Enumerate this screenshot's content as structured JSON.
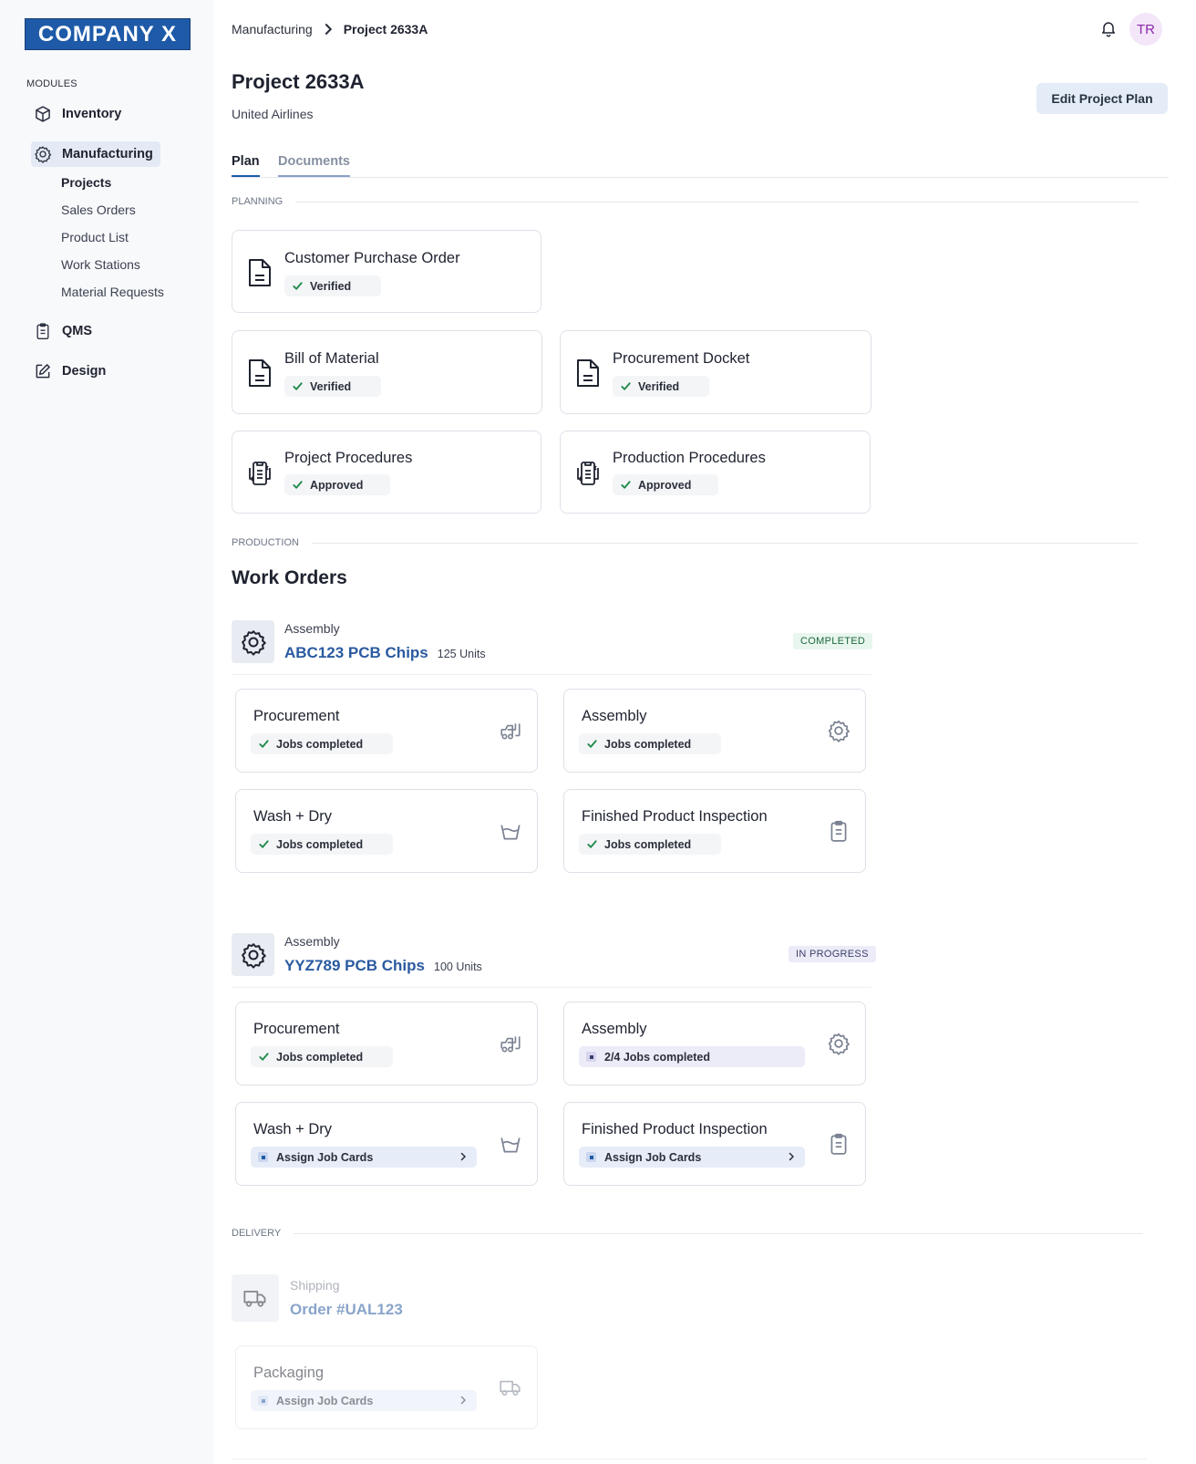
{
  "brand": {
    "logo": "COMPANY X"
  },
  "sidebar": {
    "section_label": "MODULES",
    "items": [
      {
        "label": "Inventory",
        "icon": "cube-icon"
      },
      {
        "label": "Manufacturing",
        "icon": "gear-icon",
        "active": true
      },
      {
        "label": "QMS",
        "icon": "clipboard-icon"
      },
      {
        "label": "Design",
        "icon": "edit-icon"
      }
    ],
    "subitems": [
      {
        "label": "Projects",
        "current": true
      },
      {
        "label": "Sales Orders"
      },
      {
        "label": "Product List"
      },
      {
        "label": "Work Stations"
      },
      {
        "label": "Material Requests"
      }
    ]
  },
  "breadcrumb": {
    "parent": "Manufacturing",
    "current": "Project 2633A"
  },
  "header": {
    "avatar_initials": "TR",
    "title": "Project 2633A",
    "subtitle": "United Airlines",
    "edit_button": "Edit Project Plan"
  },
  "tabs": [
    {
      "label": "Plan",
      "active": true
    },
    {
      "label": "Documents"
    }
  ],
  "planning": {
    "section_label": "PLANNING",
    "cards": [
      {
        "title": "Customer Purchase Order",
        "status": "Verified",
        "icon": "document-icon"
      },
      {
        "title": "Bill of Material",
        "status": "Verified",
        "icon": "document-icon"
      },
      {
        "title": "Procurement Docket",
        "status": "Verified",
        "icon": "document-icon"
      },
      {
        "title": "Project Procedures",
        "status": "Approved",
        "icon": "procedure-icon"
      },
      {
        "title": "Production Procedures",
        "status": "Approved",
        "icon": "procedure-icon"
      }
    ]
  },
  "production": {
    "section_label": "PRODUCTION",
    "heading": "Work Orders",
    "orders": [
      {
        "category": "Assembly",
        "name": "ABC123 PCB Chips",
        "units": "125 Units",
        "status": "COMPLETED",
        "steps": [
          {
            "title": "Procurement",
            "status": "Jobs completed",
            "icon": "forklift-icon"
          },
          {
            "title": "Assembly",
            "status": "Jobs completed",
            "icon": "gear-icon"
          },
          {
            "title": "Wash + Dry",
            "status": "Jobs completed",
            "icon": "basin-icon"
          },
          {
            "title": "Finished Product Inspection",
            "status": "Jobs completed",
            "icon": "clipboard-icon"
          }
        ]
      },
      {
        "category": "Assembly",
        "name": "YYZ789 PCB Chips",
        "units": "100 Units",
        "status": "IN PROGRESS",
        "steps": [
          {
            "title": "Procurement",
            "status": "Jobs completed",
            "icon": "forklift-icon"
          },
          {
            "title": "Assembly",
            "status": "2/4 Jobs completed",
            "icon": "gear-icon"
          },
          {
            "title": "Wash + Dry",
            "status": "Assign Job Cards",
            "icon": "basin-icon"
          },
          {
            "title": "Finished Product Inspection",
            "status": "Assign Job Cards",
            "icon": "clipboard-icon"
          }
        ]
      }
    ]
  },
  "delivery": {
    "section_label": "DELIVERY",
    "category": "Shipping",
    "name": "Order #UAL123",
    "steps": [
      {
        "title": "Packaging",
        "status": "Assign Job Cards",
        "icon": "truck-icon"
      }
    ]
  },
  "colors": {
    "brand": "#1e5aa8",
    "link": "#2a5aa0",
    "success": "#1f8a4a"
  }
}
